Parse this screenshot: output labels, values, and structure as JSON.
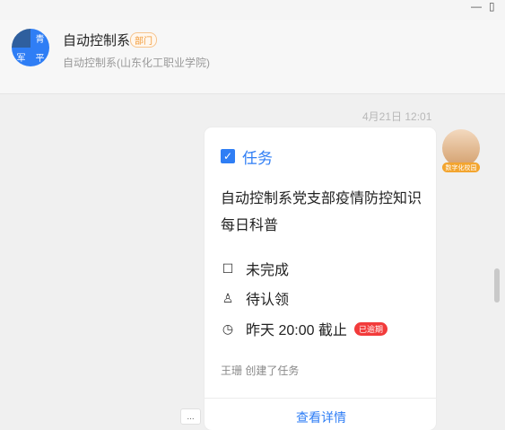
{
  "window": {
    "minimize_icon": "minimize-icon",
    "restore_icon": "restore-icon"
  },
  "chat": {
    "avatar_text": [
      "青",
      "军",
      "平"
    ],
    "name": "自动控制系",
    "dept_badge": "部门",
    "subtitle": "自动控制系(山东化工职业学院)"
  },
  "message": {
    "timestamp": "4月21日 12:01",
    "sender_badge": "数字化校园"
  },
  "task_card": {
    "label": "任务",
    "title": "自动控制系党支部疫情防控知识每日科普",
    "status": "未完成",
    "assignee": "待认领",
    "deadline": "昨天 20:00 截止",
    "overdue_badge": "已逾期",
    "creator_text": "王珊 创建了任务",
    "view_detail_label": "查看详情"
  },
  "more_button_label": "..."
}
